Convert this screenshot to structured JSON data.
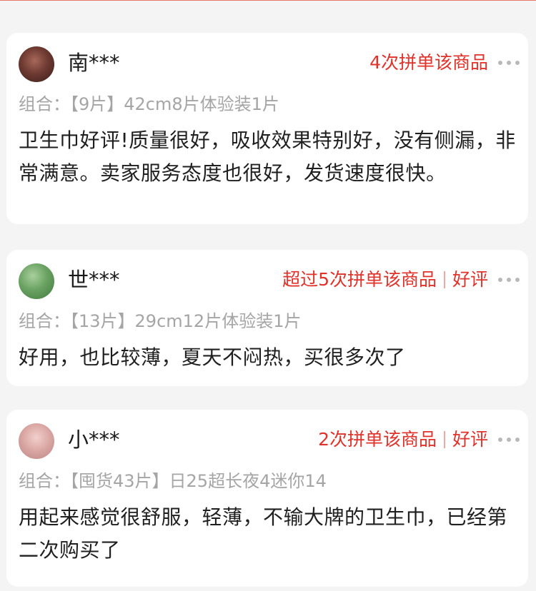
{
  "reviews": [
    {
      "username": "南***",
      "tags": [
        "4次拼单该商品"
      ],
      "variant_label": "组合：",
      "variant_value": "【9片】42cm8片体验装1片",
      "text": "卫生巾好评!质量很好，吸收效果特别好，没有侧漏，非常满意。卖家服务态度也很好，发货速度很快。"
    },
    {
      "username": "世***",
      "tags": [
        "超过5次拼单该商品",
        "好评"
      ],
      "variant_label": "组合：",
      "variant_value": "【13片】29cm12片体验装1片",
      "text": "好用，也比较薄，夏天不闷热，买很多次了"
    },
    {
      "username": "小***",
      "tags": [
        "2次拼单该商品",
        "好评"
      ],
      "variant_label": "组合：",
      "variant_value": "【囤货43片】日25超长夜4迷你14",
      "text": "用起来感觉很舒服，轻薄，不输大牌的卫生巾，已经第二次购买了"
    }
  ],
  "icons": {
    "more": "more-dots-icon",
    "avatar": "user-avatar"
  },
  "colors": {
    "tag": "#e0322b",
    "variant": "#a5a5a5",
    "text": "#1f1f1f",
    "background": "#f4f4f4"
  }
}
